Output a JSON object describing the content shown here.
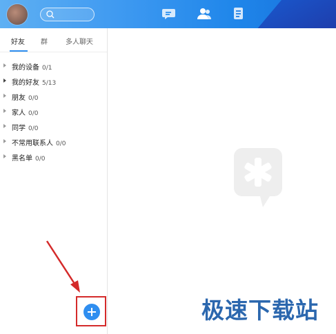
{
  "search": {
    "placeholder": ""
  },
  "nav": {
    "items": [
      "messages-icon",
      "contacts-icon",
      "notes-icon"
    ],
    "active": "contacts-icon"
  },
  "tabs": [
    {
      "label": "好友"
    },
    {
      "label": "群"
    },
    {
      "label": "多人聊天"
    }
  ],
  "groups": [
    {
      "name": "我的设备",
      "count": "0/1"
    },
    {
      "name": "我的好友",
      "count": "5/13"
    },
    {
      "name": "朋友",
      "count": "0/0"
    },
    {
      "name": "家人",
      "count": "0/0"
    },
    {
      "name": "同学",
      "count": "0/0"
    },
    {
      "name": "不常用联系人",
      "count": "0/0"
    },
    {
      "name": "黑名单",
      "count": "0/0"
    }
  ],
  "watermark": "极速下载站",
  "colors": {
    "accent": "#2e8ef0",
    "topbar": "#3f9af1",
    "highlight": "#d42a2a",
    "watermark": "#2b67ae"
  }
}
